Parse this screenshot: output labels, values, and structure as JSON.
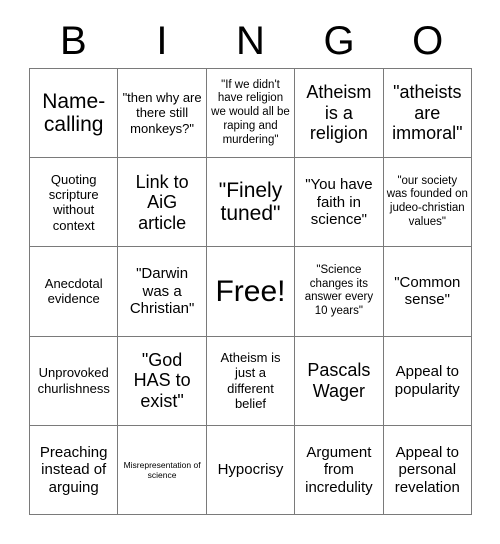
{
  "card": {
    "title": "BINGO",
    "header_letters": [
      "B",
      "I",
      "N",
      "G",
      "O"
    ],
    "grid_size": "5x5",
    "colors": {
      "background": "#ffffff",
      "text": "#000000",
      "grid_line": "#7a7a7a"
    },
    "rows": [
      [
        {
          "text": "Name-calling",
          "size": "xxl",
          "free": false
        },
        {
          "text": "\"then why are there still monkeys?\"",
          "size": "m",
          "free": false
        },
        {
          "text": "\"If we didn't have religion we would all be raping and murdering\"",
          "size": "s",
          "free": false
        },
        {
          "text": "Atheism is a religion",
          "size": "xl",
          "free": false
        },
        {
          "text": "\"atheists are immoral\"",
          "size": "xl",
          "free": false
        }
      ],
      [
        {
          "text": "Quoting scripture without context",
          "size": "m",
          "free": false
        },
        {
          "text": "Link to AiG article",
          "size": "xl",
          "free": false
        },
        {
          "text": "\"Finely tuned\"",
          "size": "xxl",
          "free": false
        },
        {
          "text": "\"You have faith in science\"",
          "size": "l",
          "free": false
        },
        {
          "text": "\"our society was founded on judeo-christian values\"",
          "size": "s",
          "free": false
        }
      ],
      [
        {
          "text": "Anecdotal evidence",
          "size": "m",
          "free": false
        },
        {
          "text": "\"Darwin was a Christian\"",
          "size": "l",
          "free": false
        },
        {
          "text": "Free!",
          "size": "free",
          "free": true
        },
        {
          "text": "\"Science changes its answer every 10 years\"",
          "size": "s",
          "free": false
        },
        {
          "text": "\"Common sense\"",
          "size": "l",
          "free": false
        }
      ],
      [
        {
          "text": "Unprovoked churlishness",
          "size": "m",
          "free": false
        },
        {
          "text": "\"God HAS to exist\"",
          "size": "xl",
          "free": false
        },
        {
          "text": "Atheism is just a different belief",
          "size": "m",
          "free": false
        },
        {
          "text": "Pascals Wager",
          "size": "xl",
          "free": false
        },
        {
          "text": "Appeal to popularity",
          "size": "l",
          "free": false
        }
      ],
      [
        {
          "text": "Preaching instead of arguing",
          "size": "l",
          "free": false
        },
        {
          "text": "Misrepresentation of science",
          "size": "xs",
          "free": false
        },
        {
          "text": "Hypocrisy",
          "size": "l",
          "free": false
        },
        {
          "text": "Argument from incredulity",
          "size": "l",
          "free": false
        },
        {
          "text": "Appeal to personal revelation",
          "size": "l",
          "free": false
        }
      ]
    ]
  }
}
